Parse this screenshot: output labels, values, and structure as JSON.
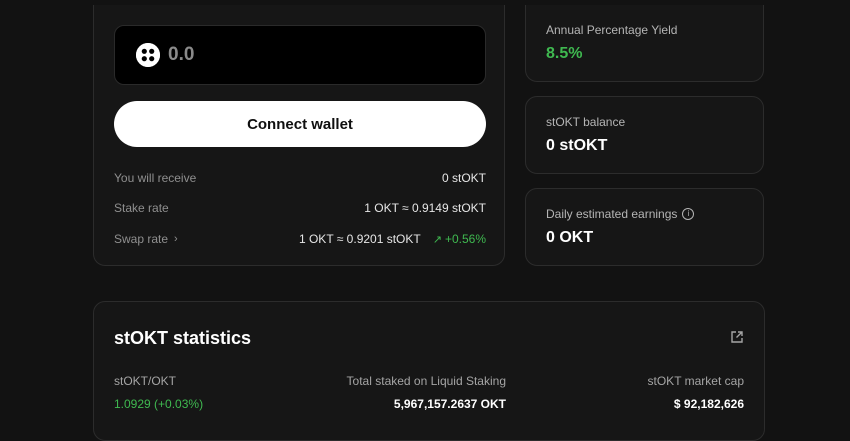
{
  "stake": {
    "amount_value": "0.0",
    "connect_button": "Connect wallet",
    "receive_label": "You will receive",
    "receive_value": "0 stOKT",
    "stake_rate_label": "Stake rate",
    "stake_rate_value": "1 OKT ≈ 0.9149 stOKT",
    "swap_rate_label": "Swap rate",
    "swap_rate_value": "1 OKT ≈ 0.9201 stOKT",
    "swap_rate_change": "+0.56%"
  },
  "stats_cards": {
    "apy_label": "Annual Percentage Yield",
    "apy_value": "8.5%",
    "balance_label": "stOKT balance",
    "balance_value": "0 stOKT",
    "earnings_label": "Daily estimated earnings",
    "earnings_value": "0 OKT"
  },
  "statistics": {
    "title": "stOKT statistics",
    "ratio_label": "stOKT/OKT",
    "ratio_value": "1.0929 (+0.03%)",
    "total_staked_label": "Total staked on Liquid Staking",
    "total_staked_value": "5,967,157.2637 OKT",
    "market_cap_label": "stOKT market cap",
    "market_cap_value": "$ 92,182,626"
  },
  "colors": {
    "background": "#121212",
    "card": "#161616",
    "positive": "#3fb950",
    "button": "#ffffff"
  },
  "icons": {
    "token": "okx-logo-icon",
    "swap_chevron": "chevron-right-icon",
    "trend": "trend-up-icon",
    "info": "info-icon",
    "external": "external-link-icon"
  }
}
